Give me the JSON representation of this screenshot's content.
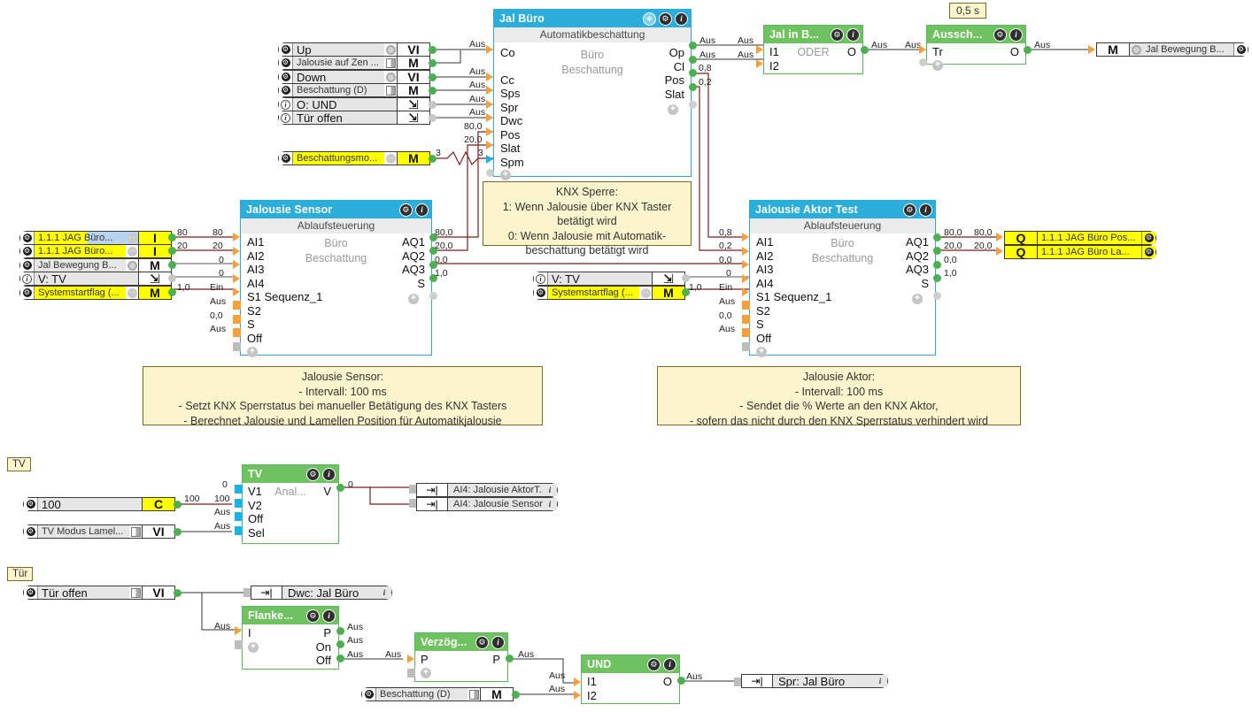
{
  "blocks": {
    "jal_buero": {
      "title": "Jal Büro",
      "subtitle": "Automatikbeschattung",
      "caption1": "Büro",
      "caption2": "Beschattung",
      "inputs": [
        "Co",
        "Cc",
        "Sps",
        "Spr",
        "Dwc",
        "Pos",
        "Slat",
        "Spm"
      ],
      "outputs": [
        "Op",
        "Cl",
        "Pos",
        "Slat"
      ]
    },
    "jal_in_b": {
      "title": "Jal in B...",
      "caption": "ODER",
      "inputs": [
        "I1",
        "I2"
      ],
      "outputs": [
        "O"
      ]
    },
    "aussch": {
      "title": "Aussch...",
      "time": "0,5 s",
      "inputs": [
        "Tr"
      ],
      "outputs": [
        "O"
      ]
    },
    "jalousie_sensor": {
      "title": "Jalousie Sensor",
      "subtitle": "Ablaufsteuerung",
      "caption1": "Büro",
      "caption2": "Beschattung",
      "inputs": [
        "AI1",
        "AI2",
        "AI3",
        "AI4",
        "S1 Sequenz_1",
        "S2",
        "S",
        "Off"
      ],
      "outputs": [
        "AQ1",
        "AQ2",
        "AQ3",
        "S"
      ]
    },
    "jalousie_aktor": {
      "title": "Jalousie Aktor Test",
      "subtitle": "Ablaufsteuerung",
      "caption1": "Büro",
      "caption2": "Beschattung",
      "inputs": [
        "AI1",
        "AI2",
        "AI3",
        "AI4",
        "S1 Sequenz_1",
        "S2",
        "S",
        "Off"
      ],
      "outputs": [
        "AQ1",
        "AQ2",
        "AQ3",
        "S"
      ]
    },
    "tv": {
      "title": "TV",
      "caption": "Anal...",
      "inputs": [
        "V1",
        "V2",
        "Off",
        "Sel"
      ],
      "outputs": [
        "V"
      ]
    },
    "flanke": {
      "title": "Flanke...",
      "inputs": [
        "I"
      ],
      "outputs": [
        "P",
        "On",
        "Off"
      ]
    },
    "verzoeg": {
      "title": "Verzög...",
      "inputs": [
        "P"
      ],
      "outputs": [
        "P"
      ]
    },
    "und": {
      "title": "UND",
      "inputs": [
        "I1",
        "I2"
      ],
      "outputs": [
        "O"
      ]
    }
  },
  "io_top": [
    {
      "label": "Up",
      "type": "VI",
      "widget": "ring",
      "icon": "gear",
      "style": "plain-big"
    },
    {
      "label": "Jalousie auf Zen ...",
      "type": "M",
      "widget": "sq",
      "icon": "gear",
      "style": "plain"
    },
    {
      "label": "Down",
      "type": "VI",
      "widget": "ring",
      "icon": "gear",
      "style": "plain-big"
    },
    {
      "label": "Beschattung (D)",
      "type": "M",
      "widget": "sq",
      "icon": "gear",
      "style": "plain"
    },
    {
      "label": "O: UND",
      "type": "EXP",
      "widget": "none",
      "icon": "info",
      "style": "plain-big"
    },
    {
      "label": "Tür offen",
      "type": "EXP",
      "widget": "none",
      "icon": "info",
      "style": "plain-big"
    }
  ],
  "io_beschattungsmo": {
    "label": "Beschattungsmo...",
    "type": "M",
    "widget": "dots",
    "icon": "gear",
    "style": "yellow"
  },
  "io_sensor_left": [
    {
      "label": "1.1.1 JAG Büro...",
      "type": "I",
      "widget": "dots",
      "icon": "gear",
      "style": "hl"
    },
    {
      "label": "1.1.1 JAG Büro...",
      "type": "I",
      "widget": "dots",
      "icon": "gear",
      "style": "yellow"
    },
    {
      "label": "Jal Bewegung B...",
      "type": "M",
      "widget": "ring",
      "icon": "gear",
      "style": "plain"
    },
    {
      "label": "V: TV",
      "type": "EXP",
      "widget": "none",
      "icon": "info",
      "style": "plain-big"
    },
    {
      "label": "Systemstartflag (...",
      "type": "M",
      "widget": "dots",
      "icon": "gear",
      "style": "yellow"
    }
  ],
  "io_aktor_left": [
    {
      "label": "V: TV",
      "type": "EXP",
      "widget": "none",
      "icon": "info",
      "style": "plain-big"
    },
    {
      "label": "Systemstartflag (...",
      "type": "M",
      "widget": "dots",
      "icon": "gear",
      "style": "yellow"
    }
  ],
  "io_aktor_right": [
    {
      "label": "1.1.1 JAG Büro Pos...",
      "type": "Q",
      "style": "yellow"
    },
    {
      "label": "1.1.1 JAG Büro La...",
      "type": "Q",
      "style": "yellow"
    }
  ],
  "io_right_m": {
    "label": "Jal Bewegung B...",
    "type": "M",
    "widget": "ring",
    "icon": "gear",
    "style": "plain"
  },
  "io_tv": {
    "const": {
      "label": "100",
      "type": "C",
      "style": "plain-big"
    },
    "modus": {
      "label": "TV Modus Lamel...",
      "type": "VI",
      "widget": "sq",
      "icon": "gear",
      "style": "plain"
    },
    "refs": [
      {
        "label": "AI4: Jalousie AktorT..."
      },
      {
        "label": "AI4: Jalousie Sensor"
      }
    ]
  },
  "io_tuer": {
    "open": {
      "label": "Tür offen",
      "type": "VI",
      "widget": "sq",
      "icon": "gear",
      "style": "plain-big"
    },
    "dwc_ref": {
      "label": "Dwc: Jal Büro"
    },
    "spr_ref": {
      "label": "Spr: Jal Büro"
    },
    "beschattung": {
      "label": "Beschattung (D)",
      "type": "M",
      "widget": "sq",
      "icon": "gear",
      "style": "plain"
    }
  },
  "notes": {
    "knx_sperre": "KNX Sperre:\n1: Wenn Jalousie über KNX Taster\nbetätigt wird\n0: Wenn Jalousie mit Automatik-\nbeschattung betätigt wird",
    "sensor": "Jalousie Sensor:\n- Intervall: 100 ms\n- Setzt KNX Sperrstatus bei manueller Betätigung des KNX Tasters\n- Berechnet Jalousie und Lamellen Position für Automatikjalousie",
    "aktor": "Jalousie Aktor:\n- Intervall: 100 ms\n- Sendet die % Werte an den KNX Aktor,\n- sofern das nicht durch den KNX Sperrstatus verhindert wird"
  },
  "tags": {
    "tv": "TV",
    "tuer": "Tür"
  },
  "values": {
    "aus": "Aus",
    "ein": "Ein",
    "v80": "80",
    "v20": "20",
    "v0": "0",
    "v800": "80,0",
    "v200": "20,0",
    "v00": "0,0",
    "v10": "1,0",
    "v08": "0,8",
    "v02": "0,2",
    "v3": "3",
    "v100": "100"
  },
  "colors": {
    "header_blue": "#2caedd",
    "header_green": "#6ec260",
    "note_bg": "#fbf4cc",
    "wire": "#7a1f1f",
    "wire_dark": "#333333",
    "port_out": "#4caf50",
    "port_in": "#f4a03c",
    "yellow": "#ffff00"
  }
}
